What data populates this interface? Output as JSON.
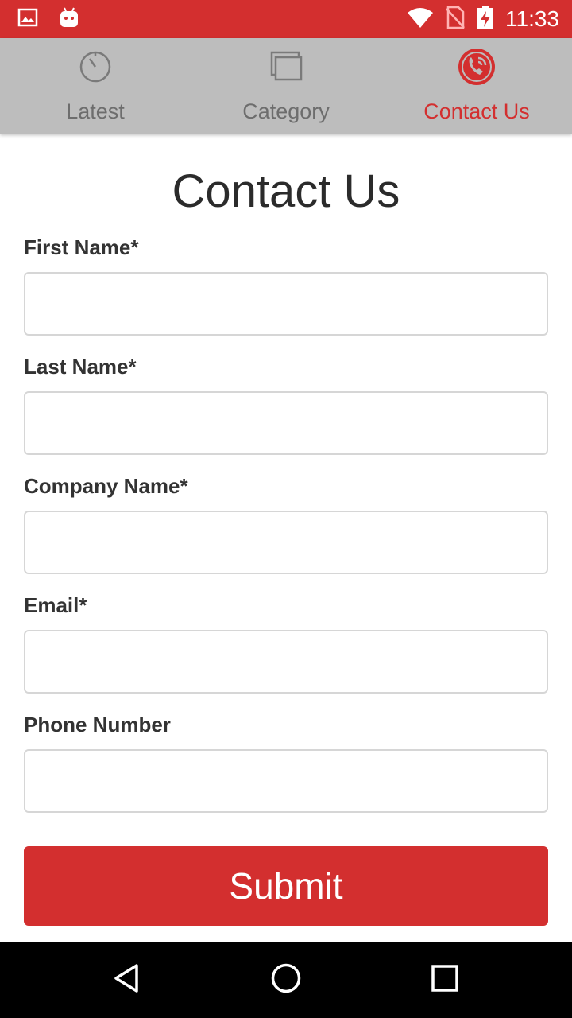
{
  "status_bar": {
    "time": "11:33",
    "icons": [
      "image-icon",
      "android-icon",
      "wifi-icon",
      "no-sim-icon",
      "battery-charging-icon"
    ],
    "background": "#d32f2f"
  },
  "tabs": [
    {
      "label": "Latest",
      "icon": "stopwatch-icon",
      "active": false
    },
    {
      "label": "Category",
      "icon": "stacked-windows-icon",
      "active": false
    },
    {
      "label": "Contact Us",
      "icon": "phone-circle-icon",
      "active": true
    }
  ],
  "page": {
    "title": "Contact Us"
  },
  "form": {
    "fields": [
      {
        "label": "First Name*",
        "value": "",
        "placeholder": ""
      },
      {
        "label": "Last Name*",
        "value": "",
        "placeholder": ""
      },
      {
        "label": "Company Name*",
        "value": "",
        "placeholder": ""
      },
      {
        "label": "Email*",
        "value": "",
        "placeholder": ""
      },
      {
        "label": "Phone Number",
        "value": "",
        "placeholder": ""
      }
    ],
    "submit_label": "Submit"
  },
  "nav_bar": {
    "buttons": [
      "back-icon",
      "home-icon",
      "recents-icon"
    ]
  },
  "colors": {
    "accent": "#d32f2f",
    "tab_bar": "#bdbdbd",
    "tab_inactive": "#6d6d6d",
    "text": "#333333"
  }
}
